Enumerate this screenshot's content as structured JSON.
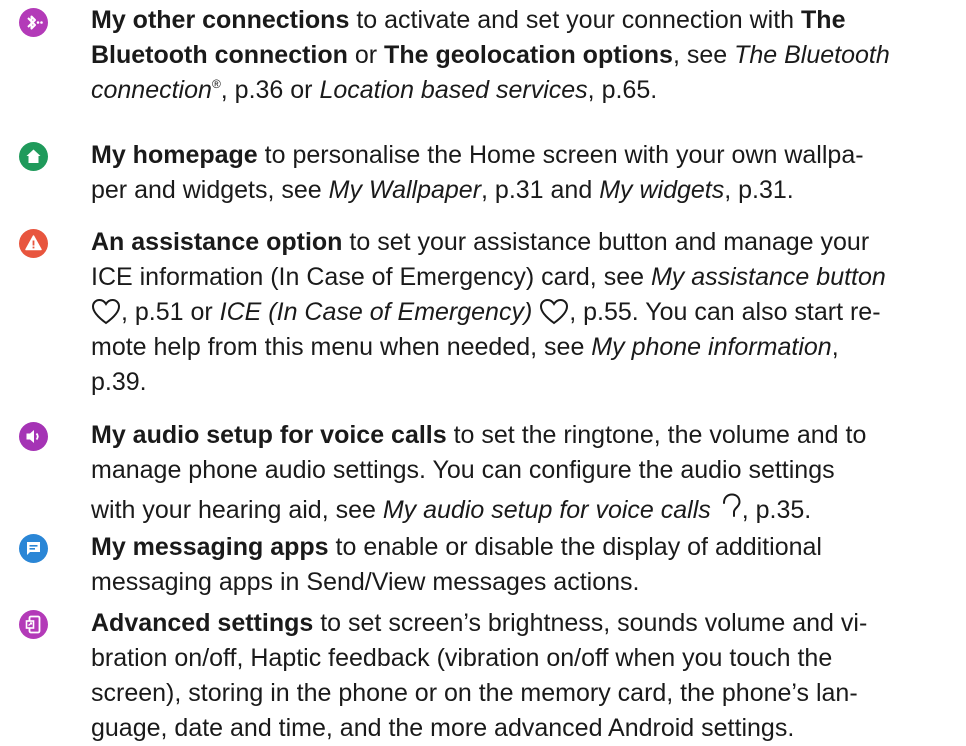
{
  "entries": [
    {
      "icon": "bluetooth-icon",
      "color": "#b33ab8",
      "title": "My other connections",
      "lines": [
        {
          "parts": [
            {
              "k": "b",
              "t": "My other connections"
            },
            {
              "k": "n",
              "t": " to activate and set your connection with "
            },
            {
              "k": "b",
              "t": "The"
            }
          ]
        },
        {
          "parts": [
            {
              "k": "b",
              "t": "Bluetooth connection"
            },
            {
              "k": "n",
              "t": " or "
            },
            {
              "k": "b",
              "t": "The geolocation options"
            },
            {
              "k": "n",
              "t": ", see "
            },
            {
              "k": "i",
              "t": "The Bluetooth"
            }
          ]
        },
        {
          "parts": [
            {
              "k": "i",
              "t": "connection"
            },
            {
              "k": "s",
              "t": "®"
            },
            {
              "k": "n",
              "t": ", p.36 or "
            },
            {
              "k": "i",
              "t": "Location based services"
            },
            {
              "k": "n",
              "t": ", p.65."
            }
          ]
        }
      ]
    },
    {
      "icon": "home-icon",
      "color": "#1f9a5b",
      "title": "My homepage",
      "lines": [
        {
          "parts": [
            {
              "k": "b",
              "t": "My homepage"
            },
            {
              "k": "n",
              "t": " to personalise the Home screen with your own wallpa-"
            }
          ]
        },
        {
          "parts": [
            {
              "k": "n",
              "t": "per and widgets, see "
            },
            {
              "k": "i",
              "t": "My Wallpaper"
            },
            {
              "k": "n",
              "t": ", p.31 and "
            },
            {
              "k": "i",
              "t": "My widgets"
            },
            {
              "k": "n",
              "t": ", p.31."
            }
          ]
        }
      ]
    },
    {
      "icon": "warning-icon",
      "color": "#e8553e",
      "title": "An assistance option",
      "lines": [
        {
          "parts": [
            {
              "k": "b",
              "t": "An assistance option"
            },
            {
              "k": "n",
              "t": " to set your assistance button and manage your"
            }
          ]
        },
        {
          "parts": [
            {
              "k": "n",
              "t": "ICE information (In Case of Emergency) card, see "
            },
            {
              "k": "i",
              "t": "My assistance button"
            }
          ]
        },
        {
          "parts": [
            {
              "k": "heart",
              "t": ""
            },
            {
              "k": "n",
              "t": ", p.51 or "
            },
            {
              "k": "i",
              "t": "ICE (In Case of Emergency) "
            },
            {
              "k": "heart",
              "t": ""
            },
            {
              "k": "n",
              "t": ", p.55. You can also start re-"
            }
          ]
        },
        {
          "parts": [
            {
              "k": "n",
              "t": "mote help from this menu when needed, see "
            },
            {
              "k": "i",
              "t": "My phone information"
            },
            {
              "k": "n",
              "t": ","
            }
          ]
        },
        {
          "parts": [
            {
              "k": "n",
              "t": "p.39."
            }
          ]
        }
      ]
    },
    {
      "icon": "speaker-icon",
      "color": "#a533b5",
      "title": "My audio setup for voice calls",
      "lines": [
        {
          "parts": [
            {
              "k": "b",
              "t": "My audio setup for voice calls"
            },
            {
              "k": "n",
              "t": " to set the ringtone, the volume and to"
            }
          ]
        },
        {
          "parts": [
            {
              "k": "n",
              "t": "manage phone audio settings. You can configure the audio settings"
            }
          ]
        },
        {
          "parts": [
            {
              "k": "n",
              "t": "with your hearing aid, see "
            },
            {
              "k": "i",
              "t": "My audio setup for voice calls "
            },
            {
              "k": "ear",
              "t": ""
            },
            {
              "k": "n",
              "t": ", p.35."
            }
          ]
        }
      ]
    },
    {
      "icon": "message-icon",
      "color": "#2a86d6",
      "title": "My messaging apps",
      "lines": [
        {
          "parts": [
            {
              "k": "b",
              "t": "My messaging apps"
            },
            {
              "k": "n",
              "t": " to enable or disable the display of additional"
            }
          ]
        },
        {
          "parts": [
            {
              "k": "n",
              "t": "messaging apps in Send/View messages actions."
            }
          ]
        }
      ]
    },
    {
      "icon": "advanced-settings-icon",
      "color": "#b33ab8",
      "title": "Advanced settings",
      "lines": [
        {
          "parts": [
            {
              "k": "b",
              "t": "Advanced settings"
            },
            {
              "k": "n",
              "t": " to set screen’s brightness, sounds volume and vi-"
            }
          ]
        },
        {
          "parts": [
            {
              "k": "n",
              "t": "bration on/off, Haptic feedback (vibration on/off when you touch the"
            }
          ]
        },
        {
          "parts": [
            {
              "k": "n",
              "t": "screen), storing in the phone or on the memory card, the phone’s lan-"
            }
          ]
        },
        {
          "parts": [
            {
              "k": "n",
              "t": "guage, date and time, and the more advanced Android settings."
            }
          ]
        }
      ]
    }
  ]
}
